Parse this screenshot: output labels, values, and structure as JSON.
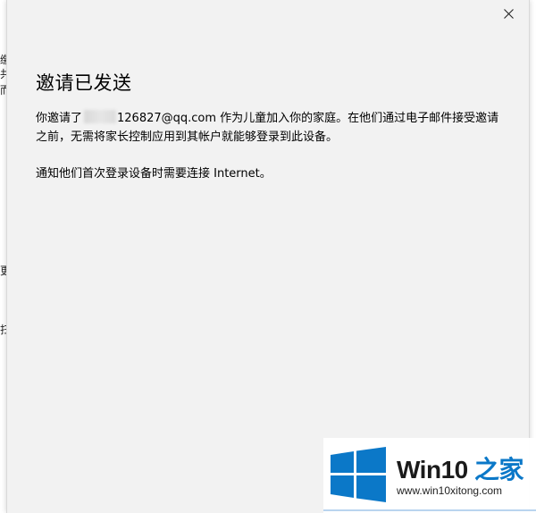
{
  "dialog": {
    "heading": "邀请已发送",
    "paragraph1_prefix": "你邀请了",
    "paragraph1_email": "126827@qq.com",
    "paragraph1_suffix": " 作为儿童加入你的家庭。在他们通过电子邮件接受邀请之前，无需将家长控制应用到其帐户就能够登录到此设备。",
    "paragraph2": "通知他们首次登录设备时需要连接 Internet。",
    "close_icon": "close-icon"
  },
  "background_window": {
    "fragments": [
      "缴",
      "共",
      "而",
      "更",
      "扫"
    ]
  },
  "watermark": {
    "brand_main": "Win10 ",
    "brand_accent": "之家",
    "url": "www.win10xitong.com",
    "logo_icon": "windows-logo-icon",
    "colors": {
      "logo": "#0b78c8",
      "accent": "#0b78c8"
    }
  }
}
